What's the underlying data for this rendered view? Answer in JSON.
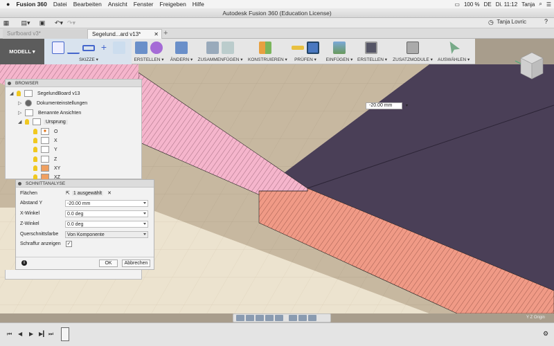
{
  "menubar": {
    "apple": "",
    "items": [
      "Fusion 360",
      "Datei",
      "Bearbeiten",
      "Ansicht",
      "Fenster",
      "Freigeben",
      "Hilfe"
    ],
    "status": {
      "battery": "100 %",
      "flag": "DE",
      "clock": "Di. 11:12",
      "user": "Tanja"
    }
  },
  "window": {
    "title": "Autodesk Fusion 360 (Education License)"
  },
  "toolbar1": {
    "user_name": "Tanja Lovric"
  },
  "tabs": [
    {
      "label": "Surfboard v3*",
      "active": false
    },
    {
      "label": "Segelund...ard v13*",
      "active": true
    }
  ],
  "ribbon": {
    "workspace": "MODELL ▾",
    "groups": [
      {
        "label": "SKIZZE ▾"
      },
      {
        "label": "ERSTELLEN ▾"
      },
      {
        "label": "ÄNDERN ▾"
      },
      {
        "label": "ZUSAMMENFÜGEN ▾"
      },
      {
        "label": "KONSTRUIEREN ▾"
      },
      {
        "label": "PRÜFEN ▾"
      },
      {
        "label": "EINFÜGEN ▾"
      },
      {
        "label": "ERSTELLEN ▾"
      },
      {
        "label": "ZUSATZMODULE ▾"
      },
      {
        "label": "AUSWÄHLEN ▾"
      }
    ]
  },
  "browser": {
    "title": "BROWSER",
    "items": [
      {
        "label": "SegelundBoard v13"
      },
      {
        "label": "Dokumenteinstellungen"
      },
      {
        "label": "Benannte Ansichten"
      },
      {
        "label": "Ursprung"
      },
      {
        "label": "O"
      },
      {
        "label": "X"
      },
      {
        "label": "Y"
      },
      {
        "label": "Z"
      },
      {
        "label": "XY"
      },
      {
        "label": "XZ"
      }
    ]
  },
  "schnitt": {
    "title": "SCHNITTANALYSE",
    "flaechen_label": "Flächen",
    "flaechen_value": "1 ausgewählt",
    "abstand_label": "Abstand Y",
    "abstand_value": "-20.00 mm",
    "xwinkel_label": "X-Winkel",
    "xwinkel_value": "0.0 deg",
    "zwinkel_label": "Z-Winkel",
    "zwinkel_value": "0.0 deg",
    "farbe_label": "Querschnittsfarbe",
    "farbe_value": "Von Komponente",
    "schraffur_label": "Schraffur anzeigen",
    "schraffur_checked": true,
    "ok": "OK",
    "cancel": "Abbrechen"
  },
  "viewport": {
    "dimension_value": "-20.00 mm",
    "axis_label": "Y Z Origin"
  },
  "colors": {
    "pink_hatch": "#f5b5cc",
    "salmon_hatch": "#f09a86",
    "dark_body": "#4a3f57",
    "floor": "#c7b8a0"
  }
}
